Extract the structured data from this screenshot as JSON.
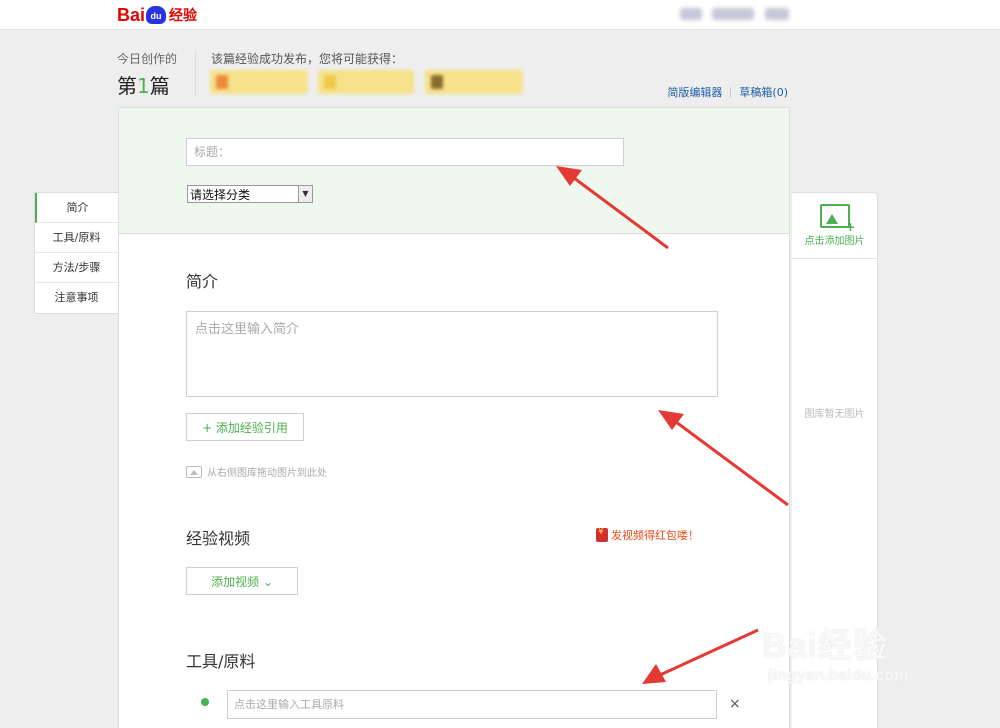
{
  "header": {
    "logo_text_bai": "Bai",
    "logo_text_du": "du",
    "logo_text_jy": "经验"
  },
  "stats": {
    "today_label": "今日创作的",
    "count_prefix": "第",
    "count_num": "1",
    "count_suffix": "篇",
    "reward_label": "该篇经验成功发布，您将可能获得："
  },
  "links": {
    "simple_editor": "简版编辑器",
    "drafts": "草稿箱(0)"
  },
  "sidenav": {
    "items": [
      {
        "label": "简介"
      },
      {
        "label": "工具/原料"
      },
      {
        "label": "方法/步骤"
      },
      {
        "label": "注意事项"
      }
    ]
  },
  "form": {
    "title_placeholder": "标题：",
    "category_value": "请选择分类",
    "intro_heading": "简介",
    "intro_placeholder": "点击这里输入简介",
    "add_ref_label": "+ 添加经验引用",
    "drag_hint": "从右侧图库拖动图片到此处",
    "video_heading": "经验视频",
    "video_promo": "发视频得红包喽！",
    "add_video_label": "添加视频 ⌄",
    "tools_heading": "工具/原料",
    "tool_placeholder": "点击这里输入工具原料",
    "tool_remove": "×"
  },
  "gallery": {
    "add_label": "点击添加图片",
    "empty_label": "图库暂无图片"
  },
  "watermark": {
    "big": "Bai经验",
    "small": "jingyan.baidu.com"
  },
  "colors": {
    "accent_green": "#4caf50",
    "header_tint": "#eef8ee",
    "arrow_red": "#e53935",
    "link_blue": "#1e5fa8"
  }
}
